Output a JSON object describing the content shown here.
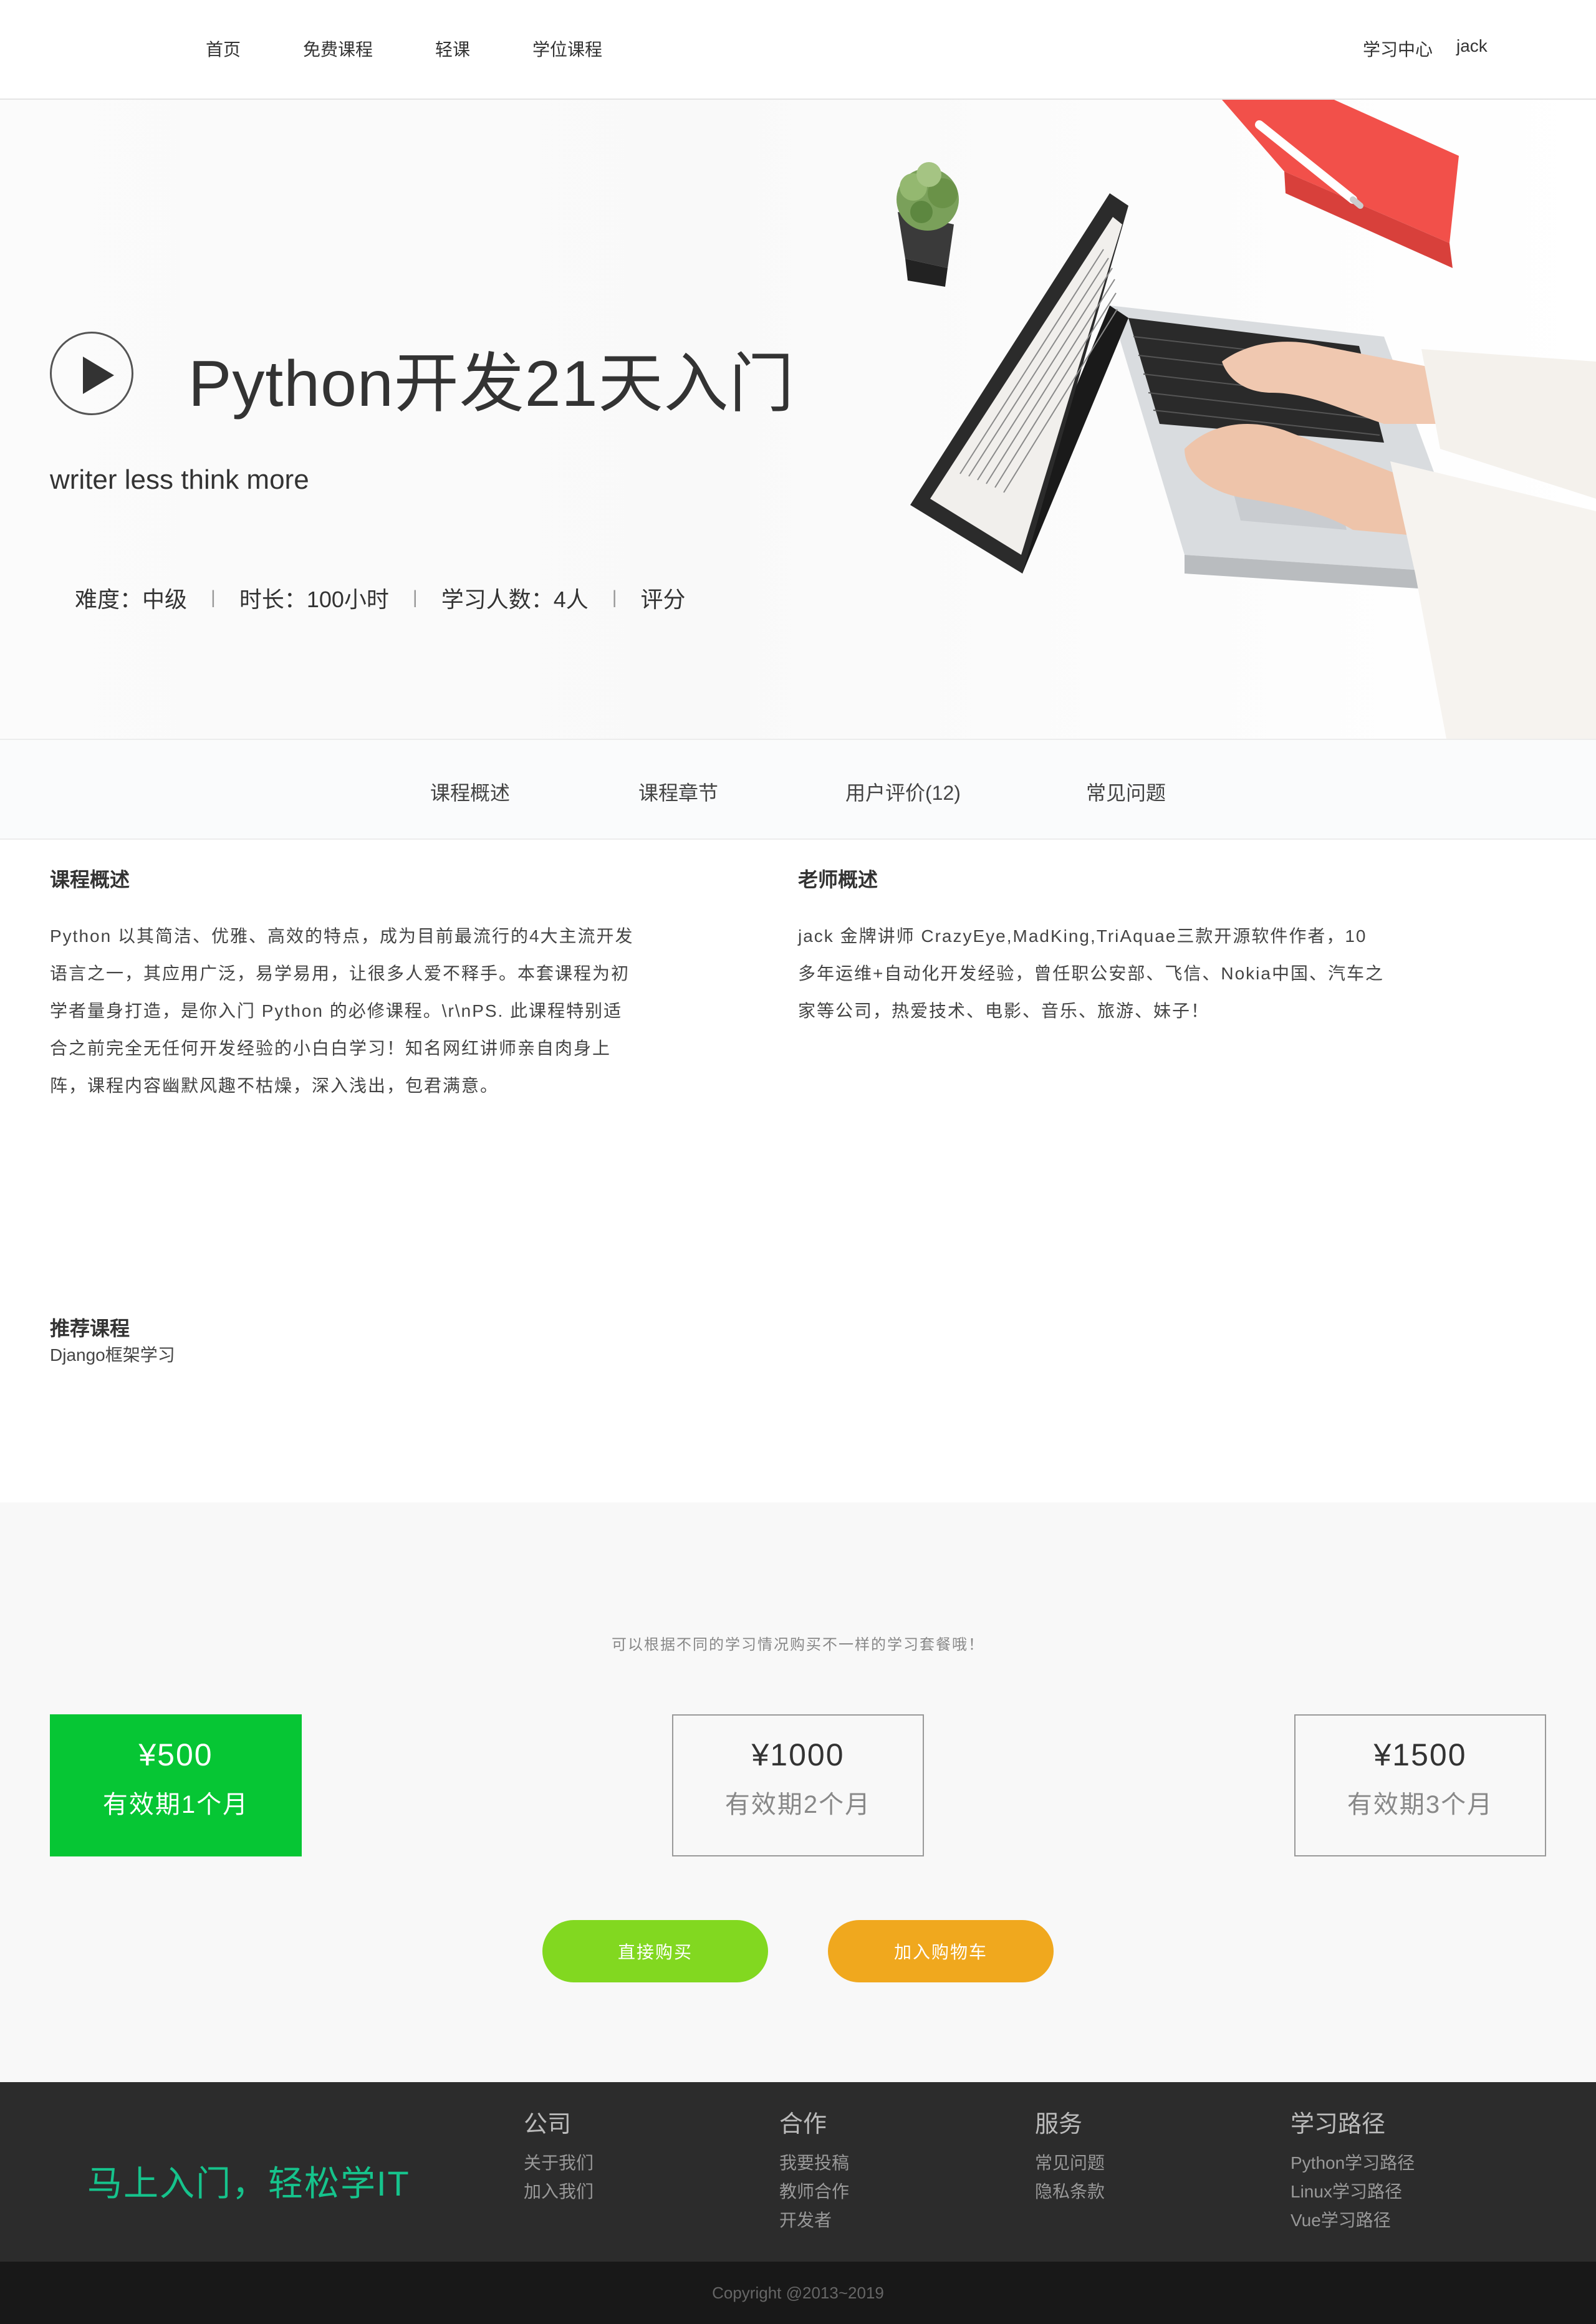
{
  "nav": {
    "items": [
      {
        "label": "首页"
      },
      {
        "label": "免费课程"
      },
      {
        "label": "轻课"
      },
      {
        "label": "学位课程"
      }
    ],
    "learning_center": "学习中心",
    "username": "jack"
  },
  "banner": {
    "title": "Python开发21天入门",
    "subtitle": "writer less think more",
    "meta": {
      "difficulty": "难度：中级",
      "duration": "时长：100小时",
      "students": "学习人数：4人",
      "rating": "评分",
      "separator": "|"
    }
  },
  "tabs": [
    {
      "label": "课程概述"
    },
    {
      "label": "课程章节"
    },
    {
      "label": "用户评价(12)"
    },
    {
      "label": "常见问题"
    }
  ],
  "overview": {
    "title": "课程概述",
    "lines": [
      "Python 以其简洁、优雅、高效的特点，成为目前最流行的4大主流开发",
      "语言之一，其应用广泛，易学易用，让很多人爱不释手。本套课程为初",
      "学者量身打造，是你入门 Python 的必修课程。\\r\\nPS. 此课程特别适",
      "合之前完全无任何开发经验的小白白学习！知名网红讲师亲自肉身上",
      "阵，课程内容幽默风趣不枯燥，深入浅出，包君满意。"
    ]
  },
  "teacher": {
    "title": "老师概述",
    "lines": [
      "jack 金牌讲师 CrazyEye,MadKing,TriAquae三款开源软件作者，10",
      "多年运维+自动化开发经验，曾任职公安部、飞信、Nokia中国、汽车之",
      "家等公司，热爱技术、电影、音乐、旅游、妹子！"
    ]
  },
  "recommend": {
    "title": "推荐课程",
    "items": [
      {
        "label": "Django框架学习"
      }
    ]
  },
  "pricing": {
    "tip": "可以根据不同的学习情况购买不一样的学习套餐哦！",
    "plans": [
      {
        "price": "¥500",
        "validity": "有效期1个月",
        "selected": true
      },
      {
        "price": "¥1000",
        "validity": "有效期2个月",
        "selected": false
      },
      {
        "price": "¥1500",
        "validity": "有效期3个月",
        "selected": false
      }
    ],
    "buy_label": "直接购买",
    "cart_label": "加入购物车",
    "colors": {
      "selected": "#06c634",
      "buy": "#82d820",
      "cart": "#f0a81e"
    }
  },
  "footer": {
    "slogan": "马上入门，轻松学IT",
    "slogan_color": "#16c38c",
    "columns": [
      {
        "title": "公司",
        "links": [
          "关于我们",
          "加入我们"
        ]
      },
      {
        "title": "合作",
        "links": [
          "我要投稿",
          "教师合作",
          "开发者"
        ]
      },
      {
        "title": "服务",
        "links": [
          "常见问题",
          "隐私条款"
        ]
      },
      {
        "title": "学习路径",
        "links": [
          "Python学习路径",
          "Linux学习路径",
          "Vue学习路径"
        ]
      }
    ],
    "copyright": "Copyright @2013~2019"
  }
}
